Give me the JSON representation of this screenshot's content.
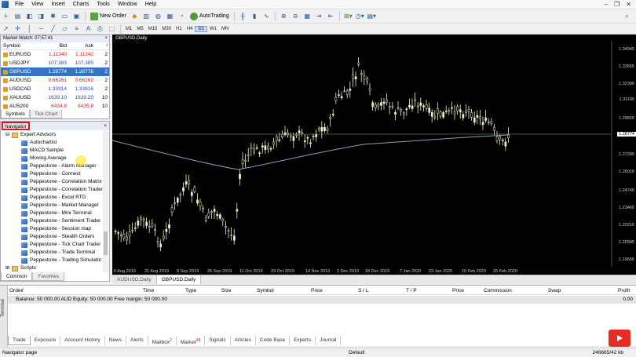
{
  "menu": [
    "File",
    "View",
    "Insert",
    "Charts",
    "Tools",
    "Window",
    "Help"
  ],
  "toolbar": {
    "new_order": "New Order",
    "autotrading": "AutoTrading",
    "timeframes": [
      "M1",
      "M5",
      "M15",
      "M30",
      "H1",
      "H4",
      "D1",
      "W1",
      "MN"
    ],
    "active_timeframe": "D1"
  },
  "market_watch": {
    "title": "Market Watch: 07:57:41",
    "headers": {
      "symbol": "Symbol",
      "bid": "Bid",
      "ask": "Ask",
      "spread": "!"
    },
    "rows": [
      {
        "symbol": "EURUSD",
        "bid": "1.11340",
        "ask": "1.11342",
        "spread": "2",
        "color": "red",
        "selected": false
      },
      {
        "symbol": "USDJPY",
        "bid": "107.383",
        "ask": "107.385",
        "spread": "2",
        "color": "blue",
        "selected": false
      },
      {
        "symbol": "GBPUSD",
        "bid": "1.28774",
        "ask": "1.28776",
        "spread": "2",
        "color": "blue",
        "selected": true
      },
      {
        "symbol": "AUDUSD",
        "bid": "0.66261",
        "ask": "0.66263",
        "spread": "2",
        "color": "red",
        "selected": false
      },
      {
        "symbol": "USDCAD",
        "bid": "1.33914",
        "ask": "1.33916",
        "spread": "2",
        "color": "blue",
        "selected": false
      },
      {
        "symbol": "XAUUSD",
        "bid": "1639.10",
        "ask": "1639.20",
        "spread": "10",
        "color": "blue",
        "selected": false
      },
      {
        "symbol": "AUS200",
        "bid": "6434.8",
        "ask": "6435.8",
        "spread": "10",
        "color": "red",
        "selected": false
      }
    ],
    "tabs": [
      "Symbols",
      "Tick Chart"
    ]
  },
  "navigator": {
    "title": "Navigator",
    "folder": "Expert Advisors",
    "items": [
      "Autochartist",
      "MACD Sample",
      "Moving Average",
      "Peppestone - Alarm Manager",
      "Peppestone - Connect",
      "Peppestone - Correlation Matrix",
      "Peppestone - Correlation Trader",
      "Peppestone - Excel RTD",
      "Peppestone - Market Manager",
      "Peppestone - Mini Terminal",
      "Peppestone - Sentiment Trader",
      "Peppestone - Session map",
      "Peppestone - Stealth Orders",
      "Peppestone - Tick Chart Trader",
      "Peppestone - Trade Terminal",
      "Peppestone - Trading Simulator"
    ],
    "scripts": "Scripts",
    "tabs": [
      "Common",
      "Favorites"
    ]
  },
  "chart": {
    "title": "GBPUSD,Daily",
    "current_price": "1.28774",
    "y_ticks": [
      "1.34940",
      "1.33665",
      "1.32390",
      "1.31100",
      "1.29810",
      "1.27290",
      "1.26010",
      "1.24740",
      "1.23460",
      "1.22210",
      "1.20940",
      "1.19665"
    ],
    "x_ticks": [
      "6 Aug 2019",
      "21 Aug 2019",
      "9 Sep 2019",
      "25 Sep 2019",
      "11 Oct 2019",
      "29 Oct 2019",
      "14 Nov 2019",
      "2 Dec 2019",
      "18 Dec 2019",
      "7 Jan 2020",
      "23 Jan 2020",
      "10 Feb 2020",
      "26 Feb 2020"
    ],
    "colors": {
      "bg": "#000000",
      "candle": "#e8f5c8",
      "ma": "#7fa3b8",
      "bid_line": "#a0a0a0"
    }
  },
  "chart_tabs": [
    "AUDUSD,Daily",
    "GBPUSD,Daily"
  ],
  "terminal": {
    "side_label": "Terminal",
    "headers": [
      "Order",
      "/",
      "Time",
      "Type",
      "Size",
      "Symbol",
      "Price",
      "S / L",
      "T / P",
      "Price",
      "Commission",
      "Swap",
      "Profit"
    ],
    "balance": "Balance: 50 000.00 AUD  Equity: 50 000.00  Free margin: 50 000.00",
    "profit": "0.00",
    "tabs": [
      {
        "label": "Trade",
        "badge": ""
      },
      {
        "label": "Exposure",
        "badge": ""
      },
      {
        "label": "Account History",
        "badge": ""
      },
      {
        "label": "News",
        "badge": ""
      },
      {
        "label": "Alerts",
        "badge": ""
      },
      {
        "label": "Mailbox",
        "badge": "2"
      },
      {
        "label": "Market",
        "badge": "98"
      },
      {
        "label": "Signals",
        "badge": ""
      },
      {
        "label": "Articles",
        "badge": ""
      },
      {
        "label": "Code Base",
        "badge": ""
      },
      {
        "label": "Experts",
        "badge": ""
      },
      {
        "label": "Journal",
        "badge": ""
      }
    ]
  },
  "status": {
    "left": "Navigator page",
    "middle": "Default",
    "right": "246665/42 kb"
  }
}
